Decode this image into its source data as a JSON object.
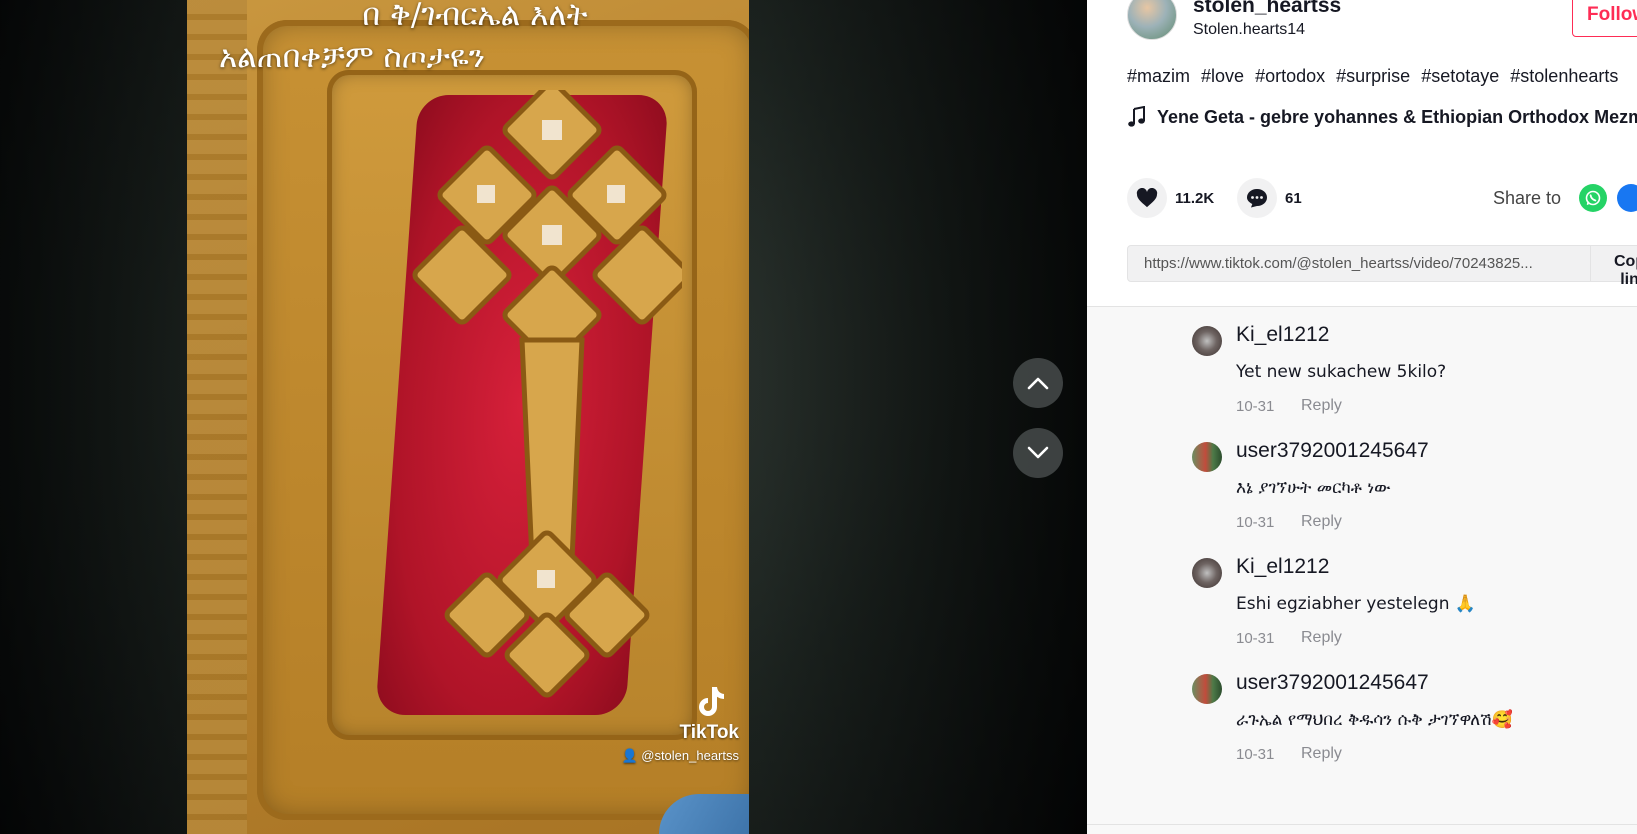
{
  "video": {
    "caption_line1": "በ ቅ/ገብርኤል እለት",
    "caption_line2": "አልጠበቀቻም ስጦታዬን",
    "watermark_brand": "TikTok",
    "watermark_handle": "@stolen_heartss"
  },
  "author": {
    "username": "stolen_heartss",
    "nickname": "Stolen.hearts14",
    "follow_label": "Follow"
  },
  "description": {
    "hashtags": [
      "#mazim",
      "#love",
      "#ortodox",
      "#surprise",
      "#setotaye",
      "#stolenhearts"
    ],
    "music": "Yene Geta - gebre yohannes & Ethiopian Orthodox Mezmur"
  },
  "actions": {
    "likes": "11.2K",
    "comments": "61",
    "share_label": "Share to",
    "share_targets": [
      "whatsapp-icon",
      "facebook-icon"
    ]
  },
  "link": {
    "url": "https://www.tiktok.com/@stolen_heartss/video/70243825...",
    "copy_label": "Copy link"
  },
  "comments": [
    {
      "user": "Ki_el1212",
      "text": "Yet new sukachew 5kilo?",
      "date": "10-31",
      "reply": "Reply"
    },
    {
      "user": "user3792001245647",
      "text": "እኔ ያገኘሁት መርካቶ ነው",
      "date": "10-31",
      "reply": "Reply"
    },
    {
      "user": "Ki_el1212",
      "text": "Eshi egziabher yestelegn 🙏",
      "date": "10-31",
      "reply": "Reply"
    },
    {
      "user": "user3792001245647",
      "text": "ራጉኤል የማህበረ ቅዱሳን ሱቅ ታገኘዋለሽ🥰",
      "date": "10-31",
      "reply": "Reply"
    }
  ],
  "colors": {
    "accent": "#fe2c55",
    "text": "#161823",
    "muted": "#8a8b91",
    "whatsapp": "#25d366",
    "facebook": "#1877f2"
  }
}
